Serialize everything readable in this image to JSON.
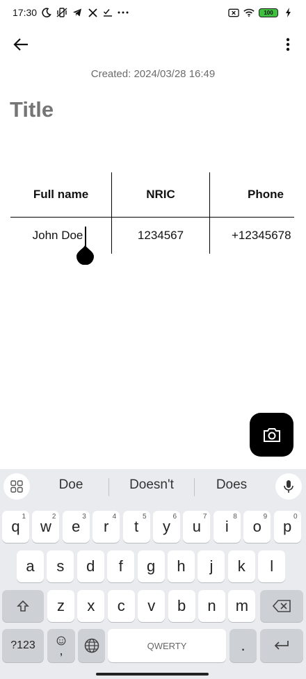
{
  "status_bar": {
    "time": "17:30",
    "left_icons": [
      "moon-icon",
      "vibrate-off-icon",
      "telegram-icon",
      "x-icon",
      "checklist-icon",
      "more-dots-icon"
    ],
    "right_icons": [
      "no-sim-icon",
      "wifi-icon",
      "battery-icon",
      "charging-icon"
    ],
    "battery": "100"
  },
  "app_bar": {
    "back_icon": "arrow-back-icon",
    "more_icon": "more-vert-icon"
  },
  "note": {
    "created": "Created: 2024/03/28 16:49",
    "title_placeholder": "Title"
  },
  "table": {
    "headers": [
      "Full name",
      "NRIC",
      "Phone"
    ],
    "rows": [
      [
        "John Doe",
        "1234567",
        "+12345678"
      ]
    ]
  },
  "fab": {
    "icon": "camera-icon"
  },
  "keyboard": {
    "suggestions": [
      "Doe",
      "Doesn't",
      "Does"
    ],
    "row1": [
      {
        "k": "q",
        "h": "1"
      },
      {
        "k": "w",
        "h": "2"
      },
      {
        "k": "e",
        "h": "3"
      },
      {
        "k": "r",
        "h": "4"
      },
      {
        "k": "t",
        "h": "5"
      },
      {
        "k": "y",
        "h": "6"
      },
      {
        "k": "u",
        "h": "7"
      },
      {
        "k": "i",
        "h": "8"
      },
      {
        "k": "o",
        "h": "9"
      },
      {
        "k": "p",
        "h": "0"
      }
    ],
    "row2": [
      "a",
      "s",
      "d",
      "f",
      "g",
      "h",
      "j",
      "k",
      "l"
    ],
    "row3": [
      "z",
      "x",
      "c",
      "v",
      "b",
      "n",
      "m"
    ],
    "sym_label": "?123",
    "emoji_comma": ",",
    "space_label": "QWERTY",
    "period": "."
  },
  "colors": {
    "fab_bg": "#000000",
    "keyboard_bg": "#e9ebee",
    "battery_green": "#3fc13f"
  }
}
